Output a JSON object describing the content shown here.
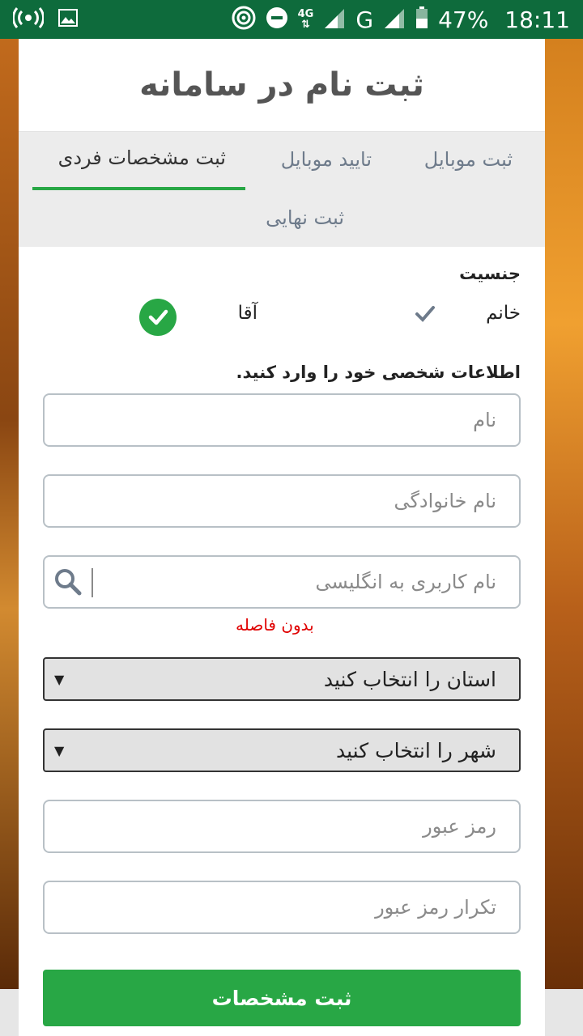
{
  "status_bar": {
    "network_type": "4G",
    "carrier_letter": "G",
    "battery_percent": "47%",
    "time": "18:11",
    "icons": [
      "hotspot-icon",
      "image-icon",
      "nfc-icon",
      "dnd-icon",
      "signal-icon",
      "battery-icon"
    ]
  },
  "page": {
    "title": "ثبت نام در سامانه"
  },
  "tabs": [
    {
      "label": "ثبت موبایل",
      "active": false
    },
    {
      "label": "تایید موبایل",
      "active": false
    },
    {
      "label": "ثبت مشخصات فردی",
      "active": true
    },
    {
      "label": "ثبت نهایی",
      "active": false
    }
  ],
  "gender": {
    "label": "جنسیت",
    "options": [
      {
        "label": "خانم",
        "selected": false
      },
      {
        "label": "آقا",
        "selected": true
      }
    ]
  },
  "form": {
    "instruction": "اطلاعات شخصی خود را وارد کنید.",
    "first_name_placeholder": "نام",
    "last_name_placeholder": "نام خانوادگی",
    "username_placeholder": "نام کاربری به انگلیسی",
    "username_hint": "بدون فاصله",
    "province_select": "استان را انتخاب کنید",
    "city_select": "شهر را انتخاب کنید",
    "password_placeholder": "رمز عبور",
    "password_repeat_placeholder": "تکرار رمز عبور",
    "submit_label": "ثبت مشخصات"
  },
  "colors": {
    "status_bar": "#0e6b3c",
    "accent_green": "#28a745",
    "hint_red": "#e00000"
  }
}
